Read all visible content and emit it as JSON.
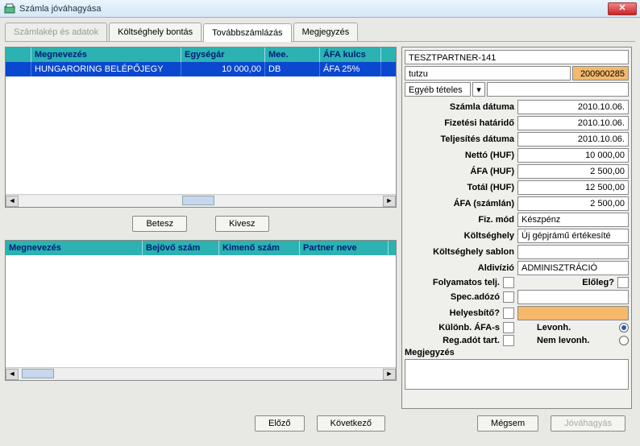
{
  "window": {
    "title": "Számla jóváhagyása"
  },
  "tabs": [
    {
      "label": "Számlakép és adatok",
      "state": "disabled"
    },
    {
      "label": "Költséghely bontás",
      "state": "normal"
    },
    {
      "label": "Továbbszámlázás",
      "state": "active"
    },
    {
      "label": "Megjegyzés",
      "state": "normal"
    }
  ],
  "grid1": {
    "headers": {
      "name": "Megnevezés",
      "price": "Egységár",
      "mee": "Mee.",
      "vat": "ÁFA kulcs"
    },
    "rows": [
      {
        "name": "HUNGARORING BELÉPŐJEGY",
        "price": "10 000,00",
        "mee": "DB",
        "vat": "ÁFA 25%"
      }
    ]
  },
  "buttons": {
    "put_in": "Betesz",
    "take_out": "Kivesz"
  },
  "grid2": {
    "headers": {
      "name": "Megnevezés",
      "in": "Bejövő szám",
      "out": "Kimenő szám",
      "partner": "Partner neve"
    }
  },
  "right": {
    "partner": "TESZTPARTNER-141",
    "tutzu": "tutzu",
    "number": "200900285",
    "other_items": "Egyéb tételes",
    "fields": {
      "invoice_date": {
        "label": "Számla dátuma",
        "value": "2010.10.06."
      },
      "due_date": {
        "label": "Fizetési határidő",
        "value": "2010.10.06."
      },
      "perf_date": {
        "label": "Teljesítés dátuma",
        "value": "2010.10.06."
      },
      "net": {
        "label": "Nettó (HUF)",
        "value": "10 000,00"
      },
      "vat": {
        "label": "ÁFA (HUF)",
        "value": "2 500,00"
      },
      "total": {
        "label": "Totál (HUF)",
        "value": "12 500,00"
      },
      "vat_inv": {
        "label": "ÁFA (számlán)",
        "value": "2 500,00"
      },
      "pay_mode": {
        "label": "Fiz. mód",
        "value": "Készpénz"
      },
      "cost_center": {
        "label": "Költséghely",
        "value": "Új gépjrámű értékesíté"
      },
      "cost_template": {
        "label": "Költséghely sablon",
        "value": ""
      },
      "division": {
        "label": "Aldivízió",
        "value": "ADMINISZTRÁCIÓ"
      }
    },
    "checks": {
      "continuous": "Folyamatos telj.",
      "advance": "Előleg?",
      "spec_tax": "Spec.adózó",
      "corrective": "Helyesbítő?",
      "diff_vat": "Különb. ÁFA-s",
      "deduct": "Levonh.",
      "reg_tax": "Reg.adót tart.",
      "non_deduct": "Nem levonh."
    },
    "note_label": "Megjegyzés"
  },
  "footer": {
    "prev": "Előző",
    "next": "Következő",
    "cancel": "Mégsem",
    "approve": "Jóváhagyás"
  }
}
